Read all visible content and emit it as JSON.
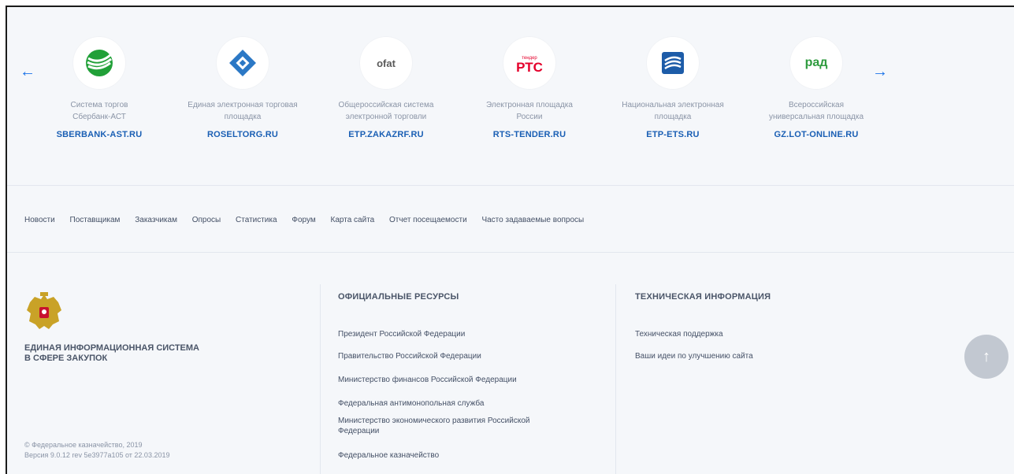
{
  "carousel": {
    "prev_arrow": "←",
    "next_arrow": "→",
    "items": [
      {
        "desc1": "Система торгов",
        "desc2": "Сбербанк-АСТ",
        "link": "SBERBANK-AST.RU"
      },
      {
        "desc1": "Единая электронная торговая",
        "desc2": "площадка",
        "link": "ROSELTORG.RU"
      },
      {
        "desc1": "Общероссийская система",
        "desc2": "электронной торговли",
        "link": "ETP.ZAKAZRF.RU",
        "logo_text": "ofat"
      },
      {
        "desc1": "Электронная площадка",
        "desc2": "России",
        "link": "RTS-TENDER.RU",
        "logo_text": "РТС",
        "logo_small": "тендер"
      },
      {
        "desc1": "Национальная электронная",
        "desc2": "площадка",
        "link": "ETP-ETS.RU"
      },
      {
        "desc1": "Всероссийская",
        "desc2": "универсальная площадка",
        "link": "GZ.LOT-ONLINE.RU",
        "logo_text": "рад"
      }
    ]
  },
  "nav": [
    "Новости",
    "Поставщикам",
    "Заказчикам",
    "Опросы",
    "Статистика",
    "Форум",
    "Карта сайта",
    "Отчет посещаемости",
    "Часто задаваемые вопросы"
  ],
  "footer": {
    "system_title_1": "ЕДИНАЯ ИНФОРМАЦИОННАЯ СИСТЕМА",
    "system_title_2": "В СФЕРЕ ЗАКУПОК",
    "copyright": "© Федеральное казначейство, 2019",
    "version": "Версия 9.0.12 rev 5e3977a105 от 22.03.2019",
    "official": {
      "heading": "ОФИЦИАЛЬНЫЕ РЕСУРСЫ",
      "links": [
        "Президент Российской Федерации",
        "Правительство Российской Федерации",
        "Министерство финансов Российской Федерации",
        "Федеральная антимонопольная служба",
        "Министерство экономического развития Российской",
        "Федерации",
        "Федеральное казначейство"
      ]
    },
    "tech": {
      "heading": "ТЕХНИЧЕСКАЯ ИНФОРМАЦИЯ",
      "links": [
        "Техническая поддержка",
        "Ваши идеи по улучшению сайта"
      ]
    },
    "up_arrow": "↑"
  },
  "colors": {
    "link": "#1a5fb4",
    "accent": "#1a73e8",
    "sber": "#21a038",
    "rts": "#e4002b",
    "rad": "#2e9b3e",
    "ets": "#1d5ca8"
  }
}
